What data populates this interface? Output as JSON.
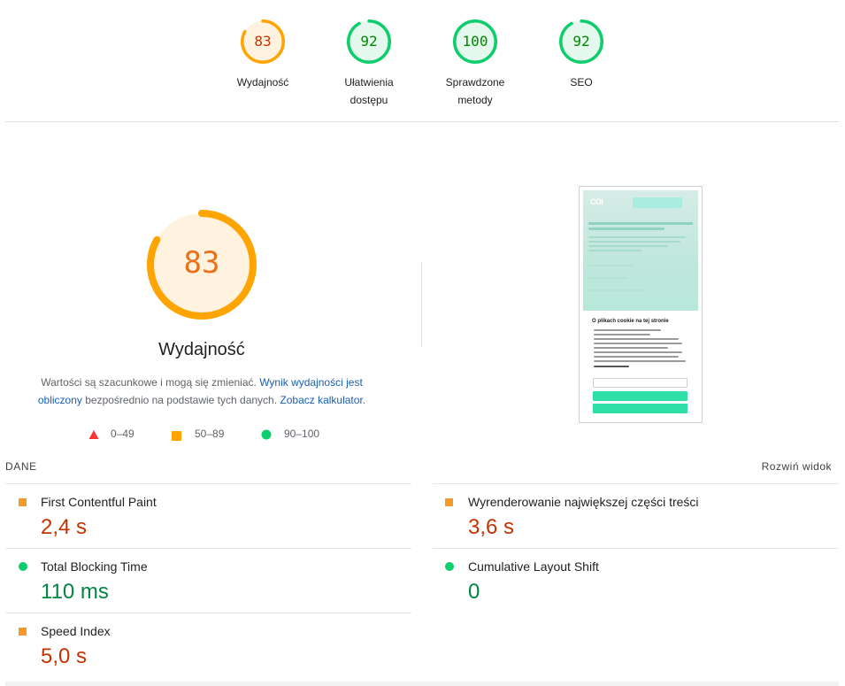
{
  "gauges": [
    {
      "score": "83",
      "label_line1": "Wydajność",
      "label_line2": "",
      "fraction": 0.83,
      "status": "average"
    },
    {
      "score": "92",
      "label_line1": "Ułatwienia",
      "label_line2": "dostępu",
      "fraction": 0.92,
      "status": "pass"
    },
    {
      "score": "100",
      "label_line1": "Sprawdzone",
      "label_line2": "metody",
      "fraction": 1.0,
      "status": "pass"
    },
    {
      "score": "92",
      "label_line1": "SEO",
      "label_line2": "",
      "fraction": 0.92,
      "status": "pass"
    }
  ],
  "main": {
    "score": "83",
    "fraction": 0.83,
    "title": "Wydajność",
    "desc_part1": "Wartości są szacunkowe i mogą się zmieniać. ",
    "desc_link1": "Wynik wydajności jest obliczony",
    "desc_part2": " bezpośrednio na podstawie tych danych. ",
    "desc_link2": "Zobacz kalkulator",
    "desc_part3": "."
  },
  "legend": [
    {
      "range": "0–49",
      "shape": "triangle-icon",
      "color": "#ff3333"
    },
    {
      "range": "50–89",
      "shape": "square-icon",
      "color": "#ffa400"
    },
    {
      "range": "90–100",
      "shape": "circle-icon",
      "color": "#0cce6b"
    }
  ],
  "thumbnail": {
    "logo": "COi",
    "cookie_title": "O plikach cookie na tej stronie"
  },
  "metrics_header": {
    "section": "DANE",
    "expand": "Rozwiń widok"
  },
  "metrics": [
    {
      "name": "First Contentful Paint",
      "value": "2,4 s",
      "status": "average"
    },
    {
      "name": "Wyrenderowanie największej części treści",
      "value": "3,6 s",
      "status": "average"
    },
    {
      "name": "Total Blocking Time",
      "value": "110 ms",
      "status": "pass"
    },
    {
      "name": "Cumulative Layout Shift",
      "value": "0",
      "status": "pass"
    },
    {
      "name": "Speed Index",
      "value": "5,0 s",
      "status": "average"
    }
  ],
  "colors": {
    "average": "#ffa400",
    "average_text": "#c33300",
    "average_bg": "#fff3e0",
    "pass": "#0cce6b",
    "pass_text": "#008800",
    "pass_bg": "#e5f8ed"
  }
}
